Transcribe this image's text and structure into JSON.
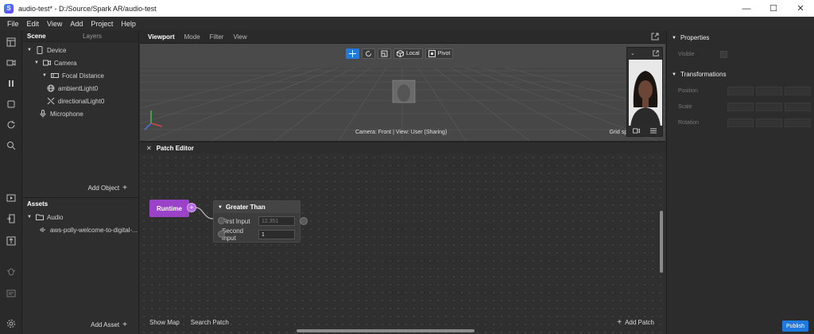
{
  "window": {
    "title": "audio-test* - D:/Source/Spark AR/audio-test",
    "minimize": "—",
    "maximize": "☐",
    "close": "✕"
  },
  "menu": [
    "File",
    "Edit",
    "View",
    "Add",
    "Project",
    "Help"
  ],
  "scene": {
    "tabs": [
      "Scene",
      "Layers"
    ],
    "tree": [
      {
        "label": "Device",
        "icon": "device-icon"
      },
      {
        "label": "Camera",
        "icon": "camera-icon"
      },
      {
        "label": "Focal Distance",
        "icon": "focal-distance-icon"
      },
      {
        "label": "ambientLight0",
        "icon": "ambient-light-icon"
      },
      {
        "label": "directionalLight0",
        "icon": "directional-light-icon"
      },
      {
        "label": "Microphone",
        "icon": "microphone-icon"
      }
    ],
    "add_object": "Add Object"
  },
  "assets": {
    "title": "Assets",
    "folder": "Audio",
    "file": "aws-polly-welcome-to-digital-...",
    "add_asset": "Add Asset"
  },
  "viewport": {
    "tabs": [
      "Viewport",
      "Mode",
      "Filter",
      "View"
    ],
    "tools": {
      "local": "Local",
      "pivot": "Pivot"
    },
    "caption": "Camera: Front | View: User (Sharing)",
    "grid_caption": "Grid spa"
  },
  "patch_editor": {
    "title": "Patch Editor",
    "runtime_label": "Runtime",
    "node_title": "Greater Than",
    "first_input_label": "First Input",
    "first_input_value": "12.351",
    "second_input_label": "Second Input",
    "second_input_value": "1",
    "show_map": "Show Map",
    "search_patch": "Search Patch",
    "add_patch": "Add Patch"
  },
  "properties": {
    "title": "Properties",
    "visible_label": "Visible",
    "transformations": "Transformations",
    "position": "Position",
    "scale": "Scale",
    "rotation": "Rotation"
  },
  "publish": "Publish",
  "colors": {
    "accent": "#1f7ae0",
    "runtime_patch": "#9b43c8"
  }
}
